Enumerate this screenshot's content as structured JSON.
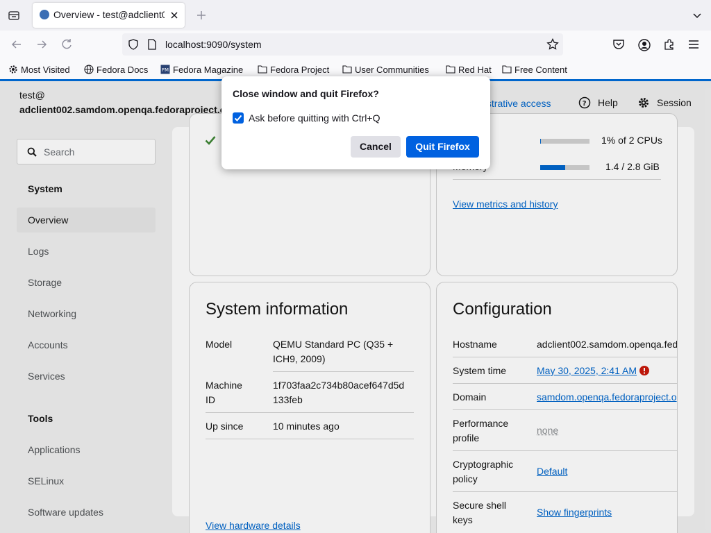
{
  "browser": {
    "tab_title": "Overview - test@adclient002",
    "url": "localhost:9090/system",
    "bookmarks": [
      "Most Visited",
      "Fedora Docs",
      "Fedora Magazine",
      "Fedora Project",
      "User Communities",
      "Red Hat",
      "Free Content"
    ]
  },
  "header": {
    "user": "test@",
    "host": "adclient002.samdom.openqa.fedoraproject.o",
    "admin_access": "nistrative access",
    "help": "Help",
    "session": "Session"
  },
  "sidebar": {
    "search_placeholder": "Search",
    "section_system": "System",
    "system_items": [
      "Overview",
      "Logs",
      "Storage",
      "Networking",
      "Accounts",
      "Services"
    ],
    "section_tools": "Tools",
    "tools_items": [
      "Applications",
      "SELinux",
      "Software updates"
    ]
  },
  "usage": {
    "cpu_value": "1% of 2 CPUs",
    "cpu_percent": 1,
    "memory_label": "Memory",
    "memory_value": "1.4 / 2.8 GiB",
    "memory_percent": 50,
    "metrics_link": "View metrics and history"
  },
  "system_info": {
    "title": "System information",
    "model_label": "Model",
    "model_value_1": "QEMU Standard PC (Q35 +",
    "model_value_2": "ICH9, 2009)",
    "machine_label_1": "Machine",
    "machine_label_2": "ID",
    "machine_value_1": "1f703faa2c734b80acef647d5d",
    "machine_value_2": "133feb",
    "up_label": "Up since",
    "up_value": "10 minutes ago",
    "hardware_link": "View hardware details"
  },
  "configuration": {
    "title": "Configuration",
    "hostname_label": "Hostname",
    "hostname_value": "adclient002.samdom.openqa.fed",
    "time_label": "System time",
    "time_value": "May 30, 2025, 2:41 AM",
    "domain_label": "Domain",
    "domain_value": "samdom.openqa.fedoraproject.o",
    "perf_label_1": "Performance",
    "perf_label_2": "profile",
    "perf_value": "none",
    "crypto_label_1": "Cryptographic",
    "crypto_label_2": "policy",
    "crypto_value": "Default",
    "ssh_label_1": "Secure shell",
    "ssh_label_2": "keys",
    "ssh_value": "Show fingerprints"
  },
  "dialog": {
    "title": "Close window and quit Firefox?",
    "checkbox_label": "Ask before quitting with Ctrl+Q",
    "checked": true,
    "cancel": "Cancel",
    "quit": "Quit Firefox"
  }
}
